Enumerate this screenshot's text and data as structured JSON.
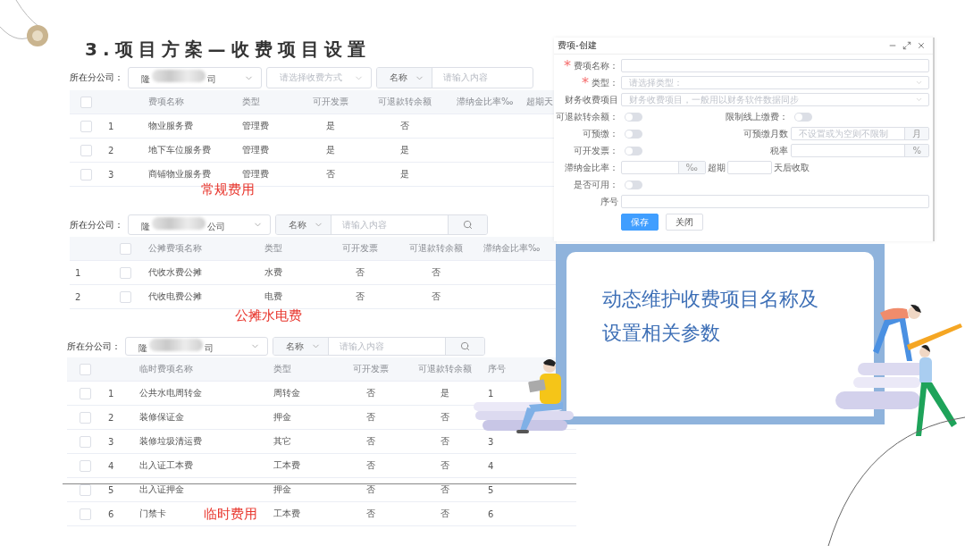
{
  "slide": {
    "title": "3.项目方案—收费项目设置",
    "callout": {
      "lines": [
        "动态维护收费项目名称及",
        "设置相关参数"
      ]
    }
  },
  "panels": [
    {
      "filter": {
        "label": "所在分公司：",
        "company": {
          "start": "隆",
          "end": "司"
        },
        "method_placeholder": "请选择收费方式",
        "field": "名称",
        "placeholder": "请输入内容",
        "search_button": false
      },
      "table": {
        "header_checked": false,
        "columns": [
          {
            "kind": "check"
          },
          {
            "kind": "index"
          },
          {
            "kind": "text",
            "label": "费项名称"
          },
          {
            "kind": "text",
            "label": "类型"
          },
          {
            "kind": "flag",
            "label": "可开发票"
          },
          {
            "kind": "flag",
            "label": "可退款转余额"
          },
          {
            "kind": "text",
            "label": "滞纳金比率‰"
          },
          {
            "kind": "text",
            "label": "超期天"
          }
        ],
        "rows": [
          {
            "checked": false,
            "cells": [
              "",
              "1",
              "物业服务费",
              "管理费",
              "是",
              "否"
            ]
          },
          {
            "checked": false,
            "cells": [
              "",
              "2",
              "地下车位服务费",
              "管理费",
              "是",
              "是"
            ]
          },
          {
            "checked": false,
            "cells": [
              "",
              "3",
              "商铺物业服务费",
              "管理费",
              "否",
              "是"
            ]
          }
        ]
      },
      "caption": "常规费用"
    },
    {
      "filter": {
        "label": "所在分公司：",
        "company": {
          "start": "隆",
          "end": "公司"
        },
        "field": "名称",
        "placeholder": "请输入内容",
        "search_button": true
      },
      "table": {
        "header_checked": false,
        "columns": [
          {
            "kind": "index"
          },
          {
            "kind": "check"
          },
          {
            "kind": "text",
            "label": "公摊费项名称"
          },
          {
            "kind": "text",
            "label": "类型"
          },
          {
            "kind": "flag",
            "label": "可开发票"
          },
          {
            "kind": "flag",
            "label": "可退款转余额"
          },
          {
            "kind": "text",
            "label": "滞纳金比率‰"
          }
        ],
        "rows": [
          {
            "checked": false,
            "cells": [
              "1",
              "",
              "代收水费公摊",
              "水费",
              "否",
              "否"
            ]
          },
          {
            "checked": false,
            "cells": [
              "2",
              "",
              "代收电费公摊",
              "电费",
              "否",
              "否"
            ]
          }
        ]
      },
      "caption": "公摊水电费"
    },
    {
      "filter": {
        "label": "所在分公司：",
        "company": {
          "start": "隆",
          "end": "司"
        },
        "field": "名称",
        "placeholder": "请输入内容",
        "search_button": true
      },
      "table": {
        "header_checked": false,
        "columns": [
          {
            "kind": "check"
          },
          {
            "kind": "index"
          },
          {
            "kind": "text",
            "label": "临时费项名称"
          },
          {
            "kind": "text",
            "label": "类型"
          },
          {
            "kind": "flag",
            "label": "可开发票"
          },
          {
            "kind": "flag",
            "label": "可退款转余额"
          },
          {
            "kind": "text",
            "label": "序号"
          }
        ],
        "rows": [
          {
            "checked": false,
            "cells": [
              "",
              "1",
              "公共水电周转金",
              "周转金",
              "否",
              "是",
              "1"
            ]
          },
          {
            "checked": false,
            "cells": [
              "",
              "2",
              "装修保证金",
              "押金",
              "否",
              "否"
            ]
          },
          {
            "checked": false,
            "cells": [
              "",
              "3",
              "装修垃圾清运费",
              "其它",
              "否",
              "否",
              "3"
            ]
          },
          {
            "checked": false,
            "cells": [
              "",
              "4",
              "出入证工本费",
              "工本费",
              "否",
              "否",
              "4"
            ]
          },
          {
            "checked": false,
            "cells": [
              "",
              "5",
              "出入证押金",
              "押金",
              "否",
              "否",
              "5"
            ]
          },
          {
            "checked": false,
            "cells": [
              "",
              "6",
              "门禁卡",
              "工本费",
              "否",
              "否",
              "6"
            ]
          }
        ]
      },
      "caption": "临时费用"
    }
  ],
  "dialog": {
    "title": "费项-创建",
    "rows": [
      {
        "kind": "input",
        "label": "费项名称：",
        "marker": "*"
      },
      {
        "kind": "select",
        "label": "类型：",
        "marker": "*",
        "placeholder": "请选择类型："
      },
      {
        "kind": "select",
        "label": "财务收费项目",
        "placeholder": "财务收费项目，一般用以财务软件数据同步"
      },
      {
        "kind": "switch-pair",
        "label": "可退款转余额：",
        "on": false,
        "right_label": "限制线上缴费：",
        "right_on": false
      },
      {
        "kind": "switch-addon",
        "label": "可预缴：",
        "on": false,
        "right_label": "可预缴月数",
        "placeholder": "不设置或为空则不限制",
        "addon": "月"
      },
      {
        "kind": "switch-addon",
        "label": "可开发票：",
        "on": false,
        "right_label": "税率",
        "addon": "%"
      },
      {
        "kind": "rate",
        "label": "滞纳金比率：",
        "addon": "‰",
        "middle": "超期",
        "after": "天后收取"
      },
      {
        "kind": "switch",
        "label": "是否可用：",
        "on": false
      },
      {
        "kind": "input",
        "label": "序号"
      }
    ],
    "buttons": [
      {
        "label": "保存",
        "primary": true
      },
      {
        "label": "关闭",
        "primary": false
      }
    ]
  }
}
